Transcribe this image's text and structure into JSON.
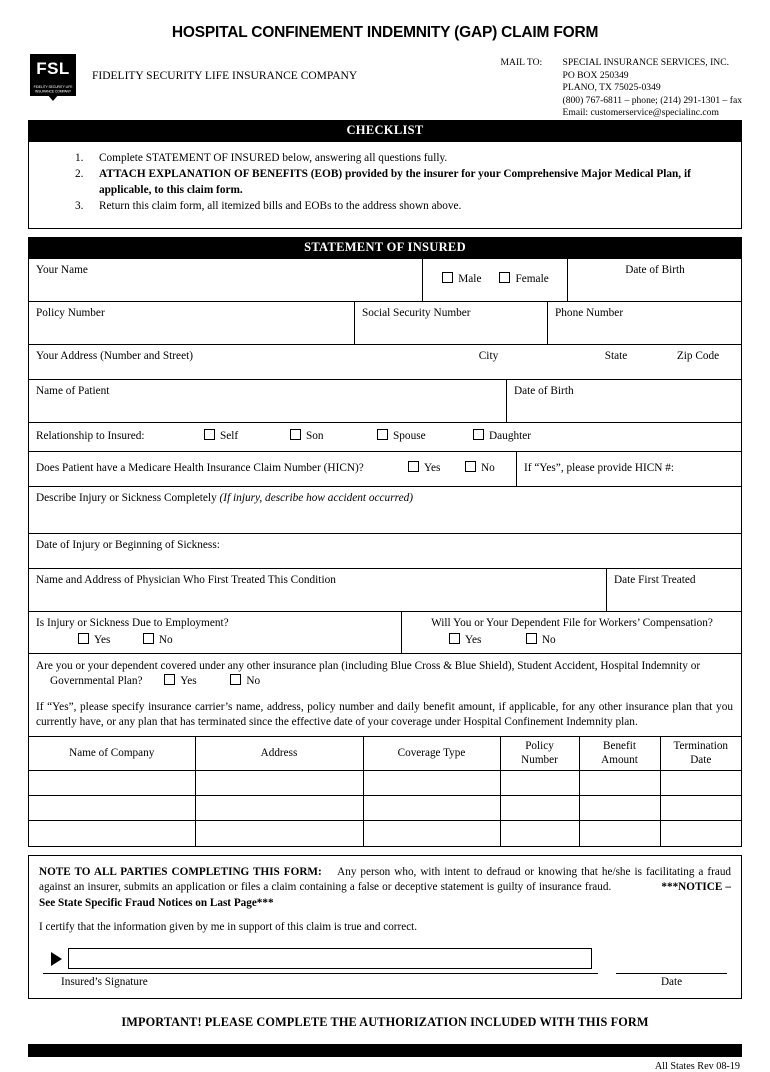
{
  "header": {
    "title": "HOSPITAL CONFINEMENT INDEMNITY (GAP) CLAIM FORM",
    "logo_text": "FSL",
    "logo_subtext": "FIDELITY SECURITY LIFE INSURANCE COMPANY",
    "company_name": "FIDELITY SECURITY LIFE INSURANCE COMPANY",
    "mail_to_label": "MAIL TO:",
    "mail_lines": [
      "SPECIAL INSURANCE SERVICES, INC.",
      "PO BOX 250349",
      "PLANO, TX  75025-0349",
      "(800) 767-6811 – phone; (214) 291-1301 – fax",
      "Email:  customerservice@specialinc.com"
    ]
  },
  "checklist": {
    "banner": "CHECKLIST",
    "items": [
      {
        "num": "1.",
        "text": "Complete STATEMENT OF INSURED below, answering all questions fully.",
        "bold": false
      },
      {
        "num": "2.",
        "text": "ATTACH EXPLANATION OF BENEFITS (EOB) provided by the insurer for your Comprehensive Major Medical Plan, if applicable, to this claim form.",
        "bold": true
      },
      {
        "num": "3.",
        "text": "Return this claim form, all itemized bills and EOBs to the address shown above.",
        "bold": false
      }
    ]
  },
  "statement": {
    "banner": "STATEMENT OF INSURED",
    "your_name": "Your Name",
    "gender_male": "Male",
    "gender_female": "Female",
    "date_of_birth": "Date of Birth",
    "policy_number": "Policy Number",
    "social_security_number": "Social Security Number",
    "phone_number": "Phone Number",
    "your_address": "Your Address (Number and Street)",
    "city": "City",
    "state": "State",
    "zip_code": "Zip Code",
    "name_of_patient": "Name of Patient",
    "patient_dob": "Date of Birth",
    "relationship_label": "Relationship to Insured:",
    "relationship_options": [
      "Self",
      "Son",
      "Spouse",
      "Daughter"
    ],
    "hicn_question": "Does Patient have a Medicare Health Insurance Claim Number (HICN)?",
    "hicn_yes": "Yes",
    "hicn_no": "No",
    "hicn_provide": "If “Yes”, please provide HICN #:",
    "describe_injury": "Describe Injury or Sickness Completely",
    "describe_injury_italic": "(If injury, describe how accident occurred)",
    "date_of_injury": "Date of Injury or Beginning of Sickness:",
    "physician_label": "Name and Address of Physician Who First Treated This Condition",
    "date_first_treated": "Date First Treated",
    "employment_question": "Is Injury or Sickness Due to Employment?",
    "employment_yes": "Yes",
    "employment_no": "No",
    "workers_comp_question": "Will You or Your Dependent File for Workers’ Compensation?",
    "workers_comp_yes": "Yes",
    "workers_comp_no": "No",
    "other_coverage_question": "Are you or your dependent covered under any other insurance plan (including Blue Cross & Blue Shield), Student Accident, Hospital Indemnity or Governmental Plan?",
    "other_coverage_yes": "Yes",
    "other_coverage_no": "No",
    "other_coverage_detail": "If “Yes”, please specify insurance carrier’s name, address, policy number and daily benefit amount, if applicable, for any other insurance plan that you currently have, or any plan that has terminated since the effective date of your coverage under Hospital Confinement Indemnity plan."
  },
  "insurance_table": {
    "headers": [
      "Name of Company",
      "Address",
      "Coverage Type",
      "Policy\nNumber",
      "Benefit\nAmount",
      "Termination\nDate"
    ],
    "headers_display": [
      [
        "Name of Company"
      ],
      [
        "Address"
      ],
      [
        "Coverage Type"
      ],
      [
        "Policy",
        "Number"
      ],
      [
        "Benefit",
        "Amount"
      ],
      [
        "Termination",
        "Date"
      ]
    ],
    "rows": [
      [
        "",
        "",
        "",
        "",
        "",
        ""
      ],
      [
        "",
        "",
        "",
        "",
        "",
        ""
      ],
      [
        "",
        "",
        "",
        "",
        "",
        ""
      ]
    ]
  },
  "note": {
    "heading": "NOTE TO ALL PARTIES COMPLETING THIS FORM:",
    "body": "Any person who, with intent to defraud or knowing that he/she is facilitating a fraud against an insurer, submits an application or files a claim containing a false or deceptive statement is guilty of insurance fraud.",
    "notice": "***NOTICE – See State Specific Fraud Notices on Last Page***",
    "certify": "I certify that the information given by me in support of this claim is true and correct.",
    "signature_label": "Insured’s Signature",
    "date_label": "Date",
    "signature_value": ""
  },
  "footer": {
    "important": "IMPORTANT!  PLEASE COMPLETE THE AUTHORIZATION INCLUDED WITH THIS FORM",
    "revision": "All States Rev 08-19"
  }
}
